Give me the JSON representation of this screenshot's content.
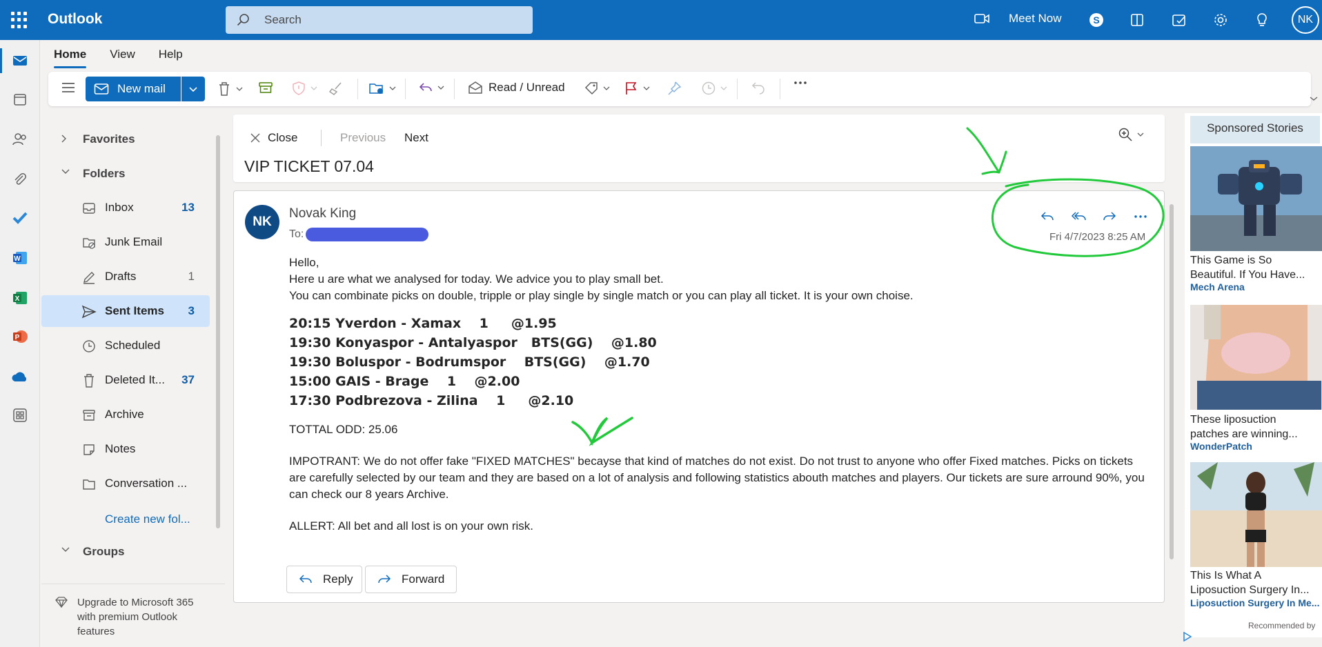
{
  "app": {
    "name": "Outlook",
    "search_placeholder": "Search",
    "meet_now": "Meet Now",
    "user_initials": "NK"
  },
  "tabs": [
    "Home",
    "View",
    "Help"
  ],
  "ribbon": {
    "new_mail": "New mail",
    "read_unread": "Read / Unread"
  },
  "folders": {
    "favorites": "Favorites",
    "folders": "Folders",
    "items": [
      {
        "label": "Inbox",
        "count": "13"
      },
      {
        "label": "Junk Email",
        "count": ""
      },
      {
        "label": "Drafts",
        "count": "1"
      },
      {
        "label": "Sent Items",
        "count": "3"
      },
      {
        "label": "Scheduled",
        "count": ""
      },
      {
        "label": "Deleted It...",
        "count": "37"
      },
      {
        "label": "Archive",
        "count": ""
      },
      {
        "label": "Notes",
        "count": ""
      },
      {
        "label": "Conversation ...",
        "count": ""
      }
    ],
    "create_new": "Create new fol...",
    "groups": "Groups",
    "upgrade": "Upgrade to Microsoft 365 with premium Outlook features"
  },
  "reading": {
    "close": "Close",
    "previous": "Previous",
    "next": "Next",
    "subject": "VIP TICKET 07.04"
  },
  "message": {
    "avatar": "NK",
    "from": "Novak King",
    "to_label": "To:",
    "date": "Fri 4/7/2023 8:25 AM",
    "greeting": "Hello,",
    "line1": "Here u are what we analysed for today. We advice you to play small bet.",
    "line2": "You can combinate picks on double, tripple or play single by single match or you can play all ticket. It is your own choise.",
    "picks": [
      "20:15 Yverdon - Xamax    1     @1.95",
      "19:30 Konyaspor - Antalyaspor   BTS(GG)    @1.80",
      "19:30 Boluspor - Bodrumspor    BTS(GG)    @1.70",
      "15:00 GAIS - Brage    1    @2.00",
      "17:30 Podbrezova - Zilina    1     @2.10"
    ],
    "total": "TOTTAL ODD: 25.06",
    "important": "IMPOTRANT: We do not offer fake \"FIXED MATCHES\" becayse that kind of matches do not exist. Do not trust to anyone who offer Fixed matches. Picks on tickets are carefully selected by our team and they are based on a lot of analysis and following statistics abouth matches and players. Our tickets are sure arround 90%, you can check our 8 years Archive.",
    "alert": "ALLERT: All bet and all lost is on your own risk.",
    "reply": "Reply",
    "forward": "Forward"
  },
  "ads": {
    "header": "Sponsored Stories",
    "items": [
      {
        "title": "This Game is So Beautiful. If You Have...",
        "source": "Mech Arena"
      },
      {
        "title": "These liposuction patches are winning...",
        "source": "WonderPatch"
      },
      {
        "title": "This Is What A Liposuction Surgery In...",
        "source": "Liposuction Surgery In Me..."
      }
    ],
    "recommended": "Recommended by"
  },
  "colors": {
    "brand": "#0f6cbd",
    "annotation": "#22c93a",
    "selected": "#cfe4fa"
  }
}
